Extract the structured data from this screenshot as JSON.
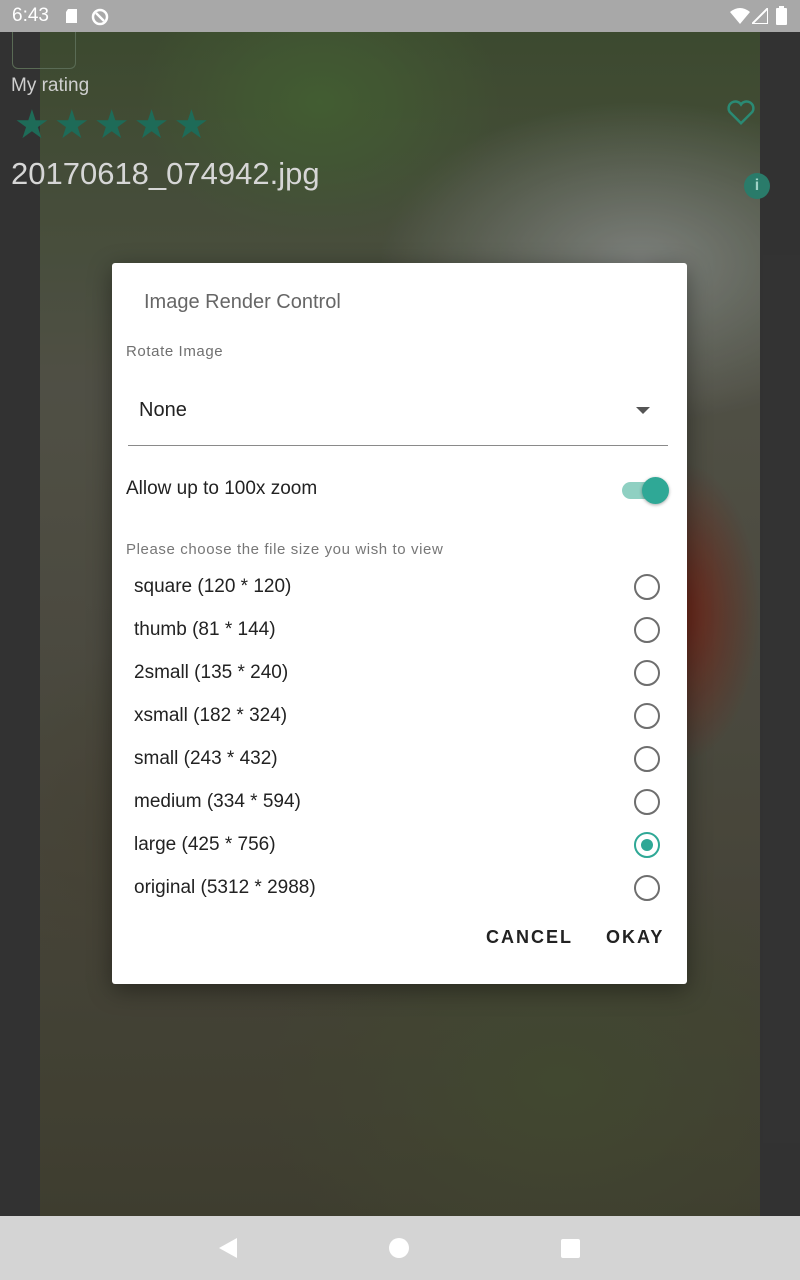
{
  "status_bar": {
    "time": "6:43"
  },
  "background": {
    "rating_label": "My rating",
    "stars": "★★★★★",
    "filename": "20170618_074942.jpg"
  },
  "dialog": {
    "title": "Image Render Control",
    "rotate_label": "Rotate Image",
    "rotate_value": "None",
    "zoom_label": "Allow up to 100x zoom",
    "zoom_enabled": true,
    "size_label": "Please choose the file size you wish to view",
    "options": [
      {
        "label": "square (120 * 120)",
        "selected": false
      },
      {
        "label": "thumb (81 * 144)",
        "selected": false
      },
      {
        "label": "2small (135 * 240)",
        "selected": false
      },
      {
        "label": "xsmall (182 * 324)",
        "selected": false
      },
      {
        "label": "small (243 * 432)",
        "selected": false
      },
      {
        "label": "medium (334 * 594)",
        "selected": false
      },
      {
        "label": "large (425 * 756)",
        "selected": true
      },
      {
        "label": "original (5312 * 2988)",
        "selected": false
      }
    ],
    "cancel_label": "CANCEL",
    "okay_label": "OKAY"
  },
  "colors": {
    "accent": "#2fa896"
  }
}
